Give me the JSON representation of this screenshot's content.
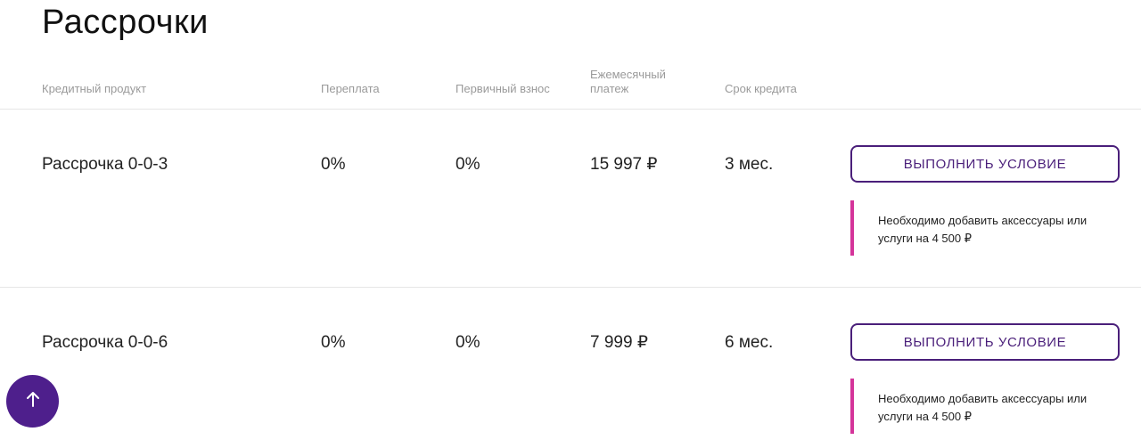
{
  "page": {
    "title": "Рассрочки"
  },
  "table": {
    "headers": {
      "product": "Кредитный продукт",
      "overpay": "Переплата",
      "initial": "Первичный взнос",
      "monthly": "Ежемесячный платеж",
      "term": "Срок кредита"
    },
    "rows": [
      {
        "product": "Рассрочка 0-0-3",
        "overpay": "0%",
        "initial": "0%",
        "monthly": "15 997 ₽",
        "term": "3 мес.",
        "action_label": "ВЫПОЛНИТЬ УСЛОВИЕ",
        "note": "Необходимо добавить аксессуары или услуги на 4 500 ₽"
      },
      {
        "product": "Рассрочка 0-0-6",
        "overpay": "0%",
        "initial": "0%",
        "monthly": "7 999 ₽",
        "term": "6 мес.",
        "action_label": "ВЫПОЛНИТЬ УСЛОВИЕ",
        "note": "Необходимо добавить аксессуары или услуги на 4 500 ₽"
      }
    ]
  },
  "scroll_top": {
    "icon": "arrow-up-icon"
  },
  "colors": {
    "accent": "#4a1f7a",
    "note_border": "#d4349a",
    "scroll_button": "#4e1f8c"
  }
}
